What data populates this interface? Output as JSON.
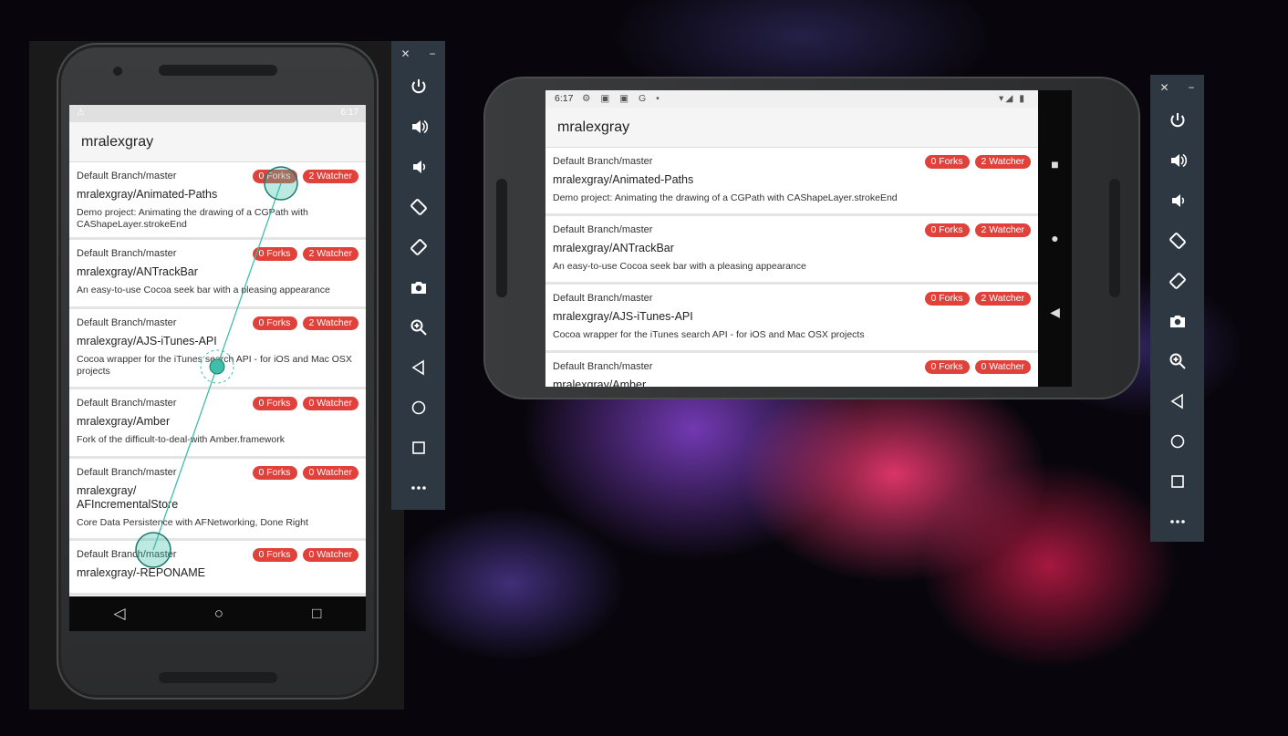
{
  "app_title": "mralexgray",
  "portrait": {
    "status_time": "6:17",
    "status_warning_icon": "warning-icon",
    "nav": {
      "back": "◁",
      "home": "○",
      "recents": "□"
    }
  },
  "landscape": {
    "status_time": "6:17",
    "status_icons": "⚙ ▣ ▣ G •",
    "status_right": "▾◢ ▮",
    "nav": {
      "back": "◀",
      "home": "●",
      "recents": "■"
    }
  },
  "repos": [
    {
      "branch": "Default Branch/master",
      "name": "mralexgray/Animated-Paths",
      "description": "Demo project: Animating the drawing of a CGPath with CAShapeLayer.strokeEnd",
      "forks": "0 Forks",
      "watchers": "2 Watcher"
    },
    {
      "branch": "Default Branch/master",
      "name": "mralexgray/ANTrackBar",
      "description": "An easy-to-use Cocoa seek bar with a pleasing appearance",
      "forks": "0 Forks",
      "watchers": "2 Watcher"
    },
    {
      "branch": "Default Branch/master",
      "name": "mralexgray/AJS-iTunes-API",
      "description": "Cocoa wrapper for the iTunes search API - for iOS and Mac OSX projects",
      "forks": "0 Forks",
      "watchers": "2 Watcher"
    },
    {
      "branch": "Default Branch/master",
      "name": "mralexgray/Amber",
      "description": "Fork of the difficult-to-deal-with Amber.framework",
      "forks": "0 Forks",
      "watchers": "0 Watcher"
    },
    {
      "branch": "Default Branch/master",
      "name": "mralexgray/\nAFIncrementalStore",
      "description": "Core Data Persistence with AFNetworking, Done Right",
      "forks": "0 Forks",
      "watchers": "0 Watcher"
    },
    {
      "branch": "Default Branch/master",
      "name": "mralexgray/-REPONAME",
      "description": "",
      "forks": "0 Forks",
      "watchers": "0 Watcher"
    }
  ],
  "landscape_partial_name": "mralexgray/Amber",
  "toolbar": {
    "close": "✕",
    "minimize": "−",
    "buttons": [
      "power-icon",
      "volume-up-icon",
      "volume-down-icon",
      "rotate-left-icon",
      "rotate-right-icon",
      "camera-icon",
      "zoom-icon",
      "back-icon",
      "home-icon",
      "overview-icon",
      "more-icon"
    ]
  },
  "colors": {
    "badge": "#e0413a",
    "toolbar": "#2e3842",
    "touch_indicator": "#3fbfa8"
  }
}
